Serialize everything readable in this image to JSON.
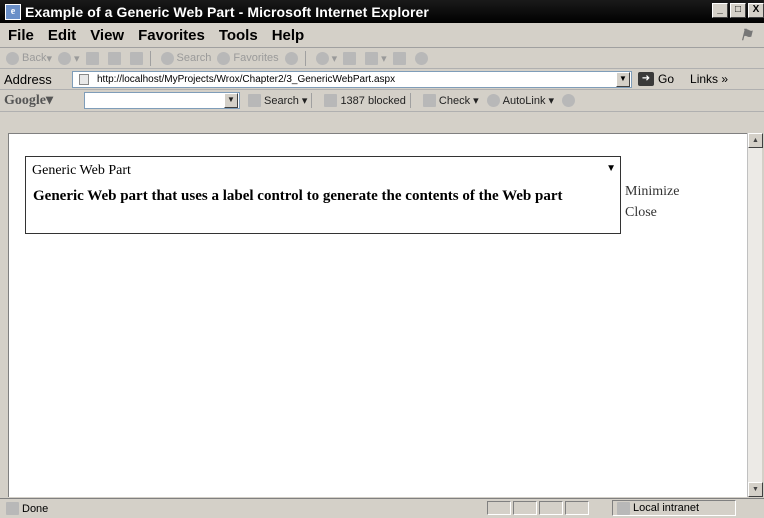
{
  "window": {
    "title": "Example of a Generic Web Part - Microsoft Internet Explorer",
    "controls": [
      "_",
      "□",
      "X"
    ]
  },
  "menubar": {
    "items": [
      "File",
      "Edit",
      "View",
      "Favorites",
      "Tools",
      "Help"
    ]
  },
  "toolbar": {
    "back": "Back",
    "search": "Search",
    "favorites": "Favorites"
  },
  "addressbar": {
    "label": "Address",
    "url": "http://localhost/MyProjects/Wrox/Chapter2/3_GenericWebPart.aspx",
    "go": "Go",
    "links": "Links"
  },
  "googlebar": {
    "logo": "Google",
    "search": "Search",
    "blocked": "1387 blocked",
    "check": "Check",
    "autolink": "AutoLink"
  },
  "webpart": {
    "title": "Generic Web Part",
    "body": "Generic Web part that uses a label control to generate the contents of the Web part",
    "verbs": [
      "Minimize",
      "Close"
    ]
  },
  "statusbar": {
    "status": "Done",
    "zone": "Local intranet"
  }
}
